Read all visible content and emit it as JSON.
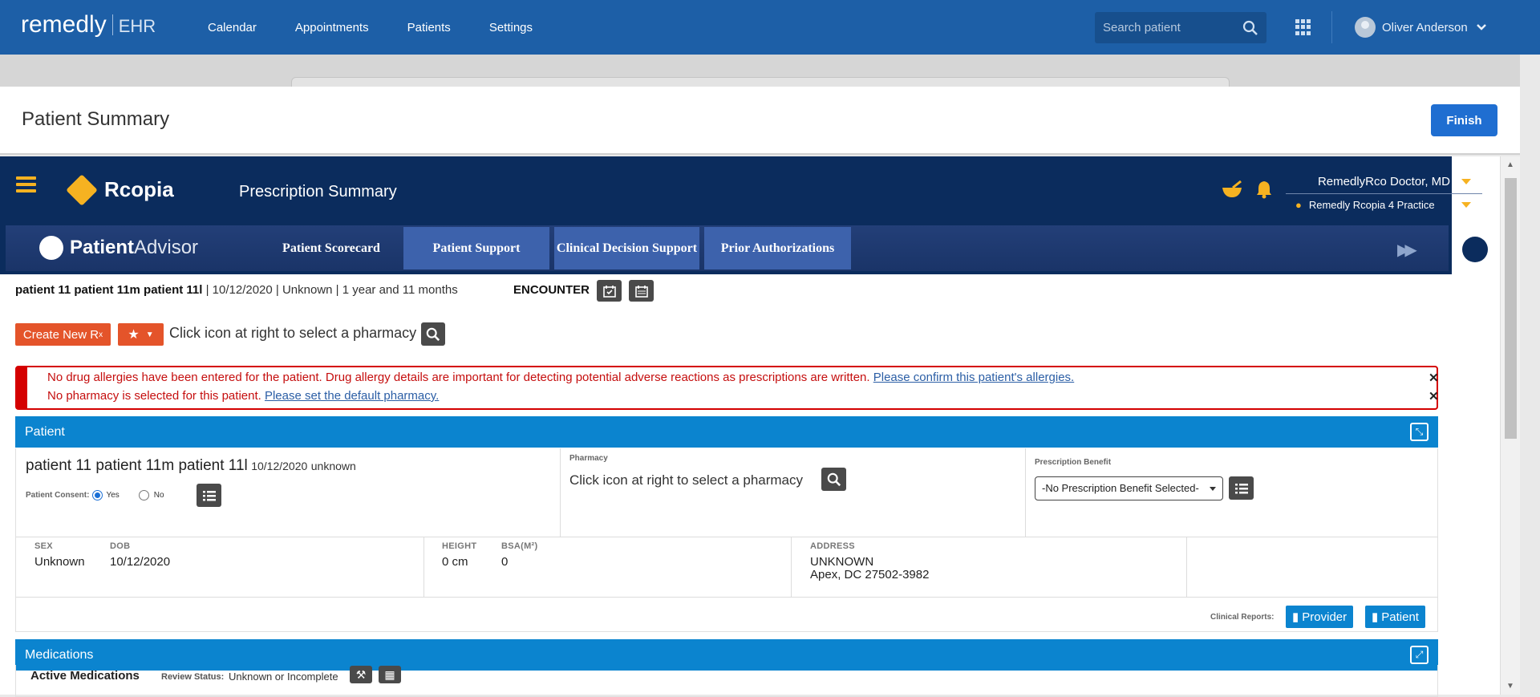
{
  "app": {
    "logo_main": "remedly",
    "logo_sub": "EHR"
  },
  "nav": {
    "items": [
      "Calendar",
      "Appointments",
      "Patients",
      "Settings"
    ]
  },
  "search": {
    "placeholder": "Search patient"
  },
  "user": {
    "name": "Oliver Anderson"
  },
  "page": {
    "title": "Patient Summary",
    "finish_label": "Finish"
  },
  "rcopia": {
    "logo": "Rcopia",
    "title": "Prescription Summary",
    "doctor": "RemedlyRco Doctor, MD",
    "practice": "Remedly Rcopia 4 Practice"
  },
  "patient_advisor": {
    "logo_bold": "Patient",
    "logo_light": "Advisor",
    "tabs": [
      {
        "label": "Patient Scorecard"
      },
      {
        "label": "Patient Support"
      },
      {
        "label": "Clinical Decision Support"
      },
      {
        "label": "Prior Authorizations"
      }
    ]
  },
  "patient_line": {
    "name": "patient 11 patient 11m patient 11l",
    "details": " | 10/12/2020 | Unknown | 1 year and 11 months",
    "encounter": "ENCOUNTER"
  },
  "actions": {
    "create_rx": "Create New R",
    "create_rx_sub": "x",
    "pharmacy_hint": "Click icon at right to select a pharmacy"
  },
  "alerts": {
    "allergy_text": "No drug allergies have been entered for the patient. Drug allergy details are important for detecting potential adverse reactions as prescriptions are written. ",
    "allergy_link": "Please confirm this patient's allergies.",
    "pharmacy_text": "No pharmacy is selected for this patient. ",
    "pharmacy_link": "Please set the default pharmacy.",
    "close": "✕"
  },
  "patient_panel": {
    "title": "Patient",
    "name": "patient 11 patient 11m patient 11l",
    "dob_inline": "10/12/2020",
    "sex_inline": "unknown",
    "consent_label": "Patient Consent:",
    "consent_yes": "Yes",
    "consent_no": "No",
    "consent_value": "Yes",
    "pharmacy_label": "Pharmacy",
    "pharmacy_hint": "Click icon at right to select a pharmacy",
    "benefit_label": "Prescription Benefit",
    "benefit_value": "-No Prescription Benefit Selected-",
    "sex_label": "SEX",
    "sex": "Unknown",
    "dob_label": "DOB",
    "dob": "10/12/2020",
    "height_label": "HEIGHT",
    "height": "0 cm",
    "bsa_label": "BSA(M²)",
    "bsa": "0",
    "address_label": "ADDRESS",
    "address_line1": "UNKNOWN",
    "address_line2": "Apex, DC 27502-3982",
    "reports_label": "Clinical Reports:",
    "report_provider": "Provider",
    "report_patient": "Patient"
  },
  "meds_panel": {
    "title": "Medications",
    "active": "Active Medications",
    "review_label": "Review Status:",
    "review_value": "Unknown or Incomplete"
  }
}
